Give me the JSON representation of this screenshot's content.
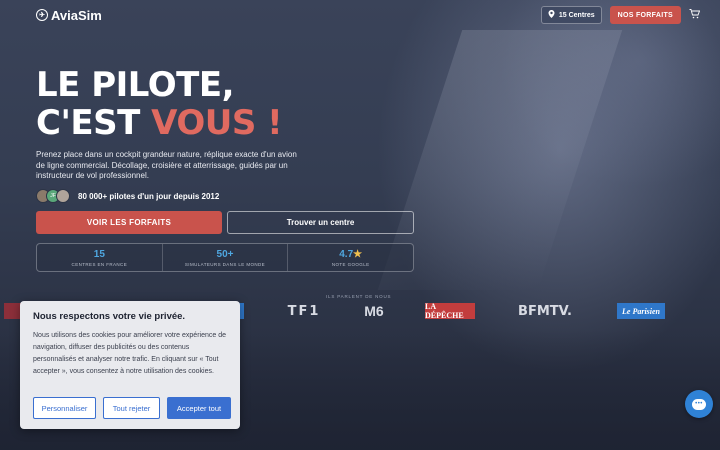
{
  "header": {
    "logo_text": "AviaSim",
    "centres_label": "15 Centres",
    "forfaits_label": "NOS FORFAITS",
    "icons": {
      "logo": "plane-logo-icon",
      "location": "location-pin-icon",
      "cart": "cart-icon"
    }
  },
  "hero": {
    "headline_line1": "LE PILOTE,",
    "headline_line2_a": "C'EST ",
    "headline_line2_b": "VOUS !",
    "subtext": "Prenez place dans un cockpit grandeur nature, réplique exacte d'un avion de ligne commercial. Décollage, croisière et atterrissage, guidés par un instructeur de vol professionnel.",
    "social_proof": "80 000+ pilotes d'un jour depuis 2012",
    "avatar_initials": "JF",
    "cta_primary": "VOIR LES FORFAITS",
    "cta_secondary": "Trouver un centre",
    "accent_color": "#c9534c"
  },
  "stats": [
    {
      "value": "15",
      "label": "CENTRES EN FRANCE"
    },
    {
      "value": "50+",
      "label": "SIMULATEURS DANS LE MONDE"
    },
    {
      "value": "4.7",
      "star": "★",
      "label": "NOTE GOOGLE"
    }
  ],
  "press": {
    "label": "ILS PARLENT DE NOUS",
    "logos": [
      "TF1",
      "M6",
      "LA DÉPÊCHE",
      "BFMTV.",
      "Le Parisien"
    ]
  },
  "cookie": {
    "title": "Nous respectons votre vie privée.",
    "body": "Nous utilisons des cookies pour améliorer votre expérience de navigation, diffuser des publicités ou des contenus personnalisés et analyser notre trafic. En cliquant sur « Tout accepter », vous consentez à notre utilisation des cookies.",
    "btn_customize": "Personnaliser",
    "btn_reject": "Tout rejeter",
    "btn_accept": "Accepter tout",
    "button_color": "#3a6fd0"
  },
  "chat": {
    "icon": "chat-bubble-icon",
    "glyph": "•••"
  }
}
